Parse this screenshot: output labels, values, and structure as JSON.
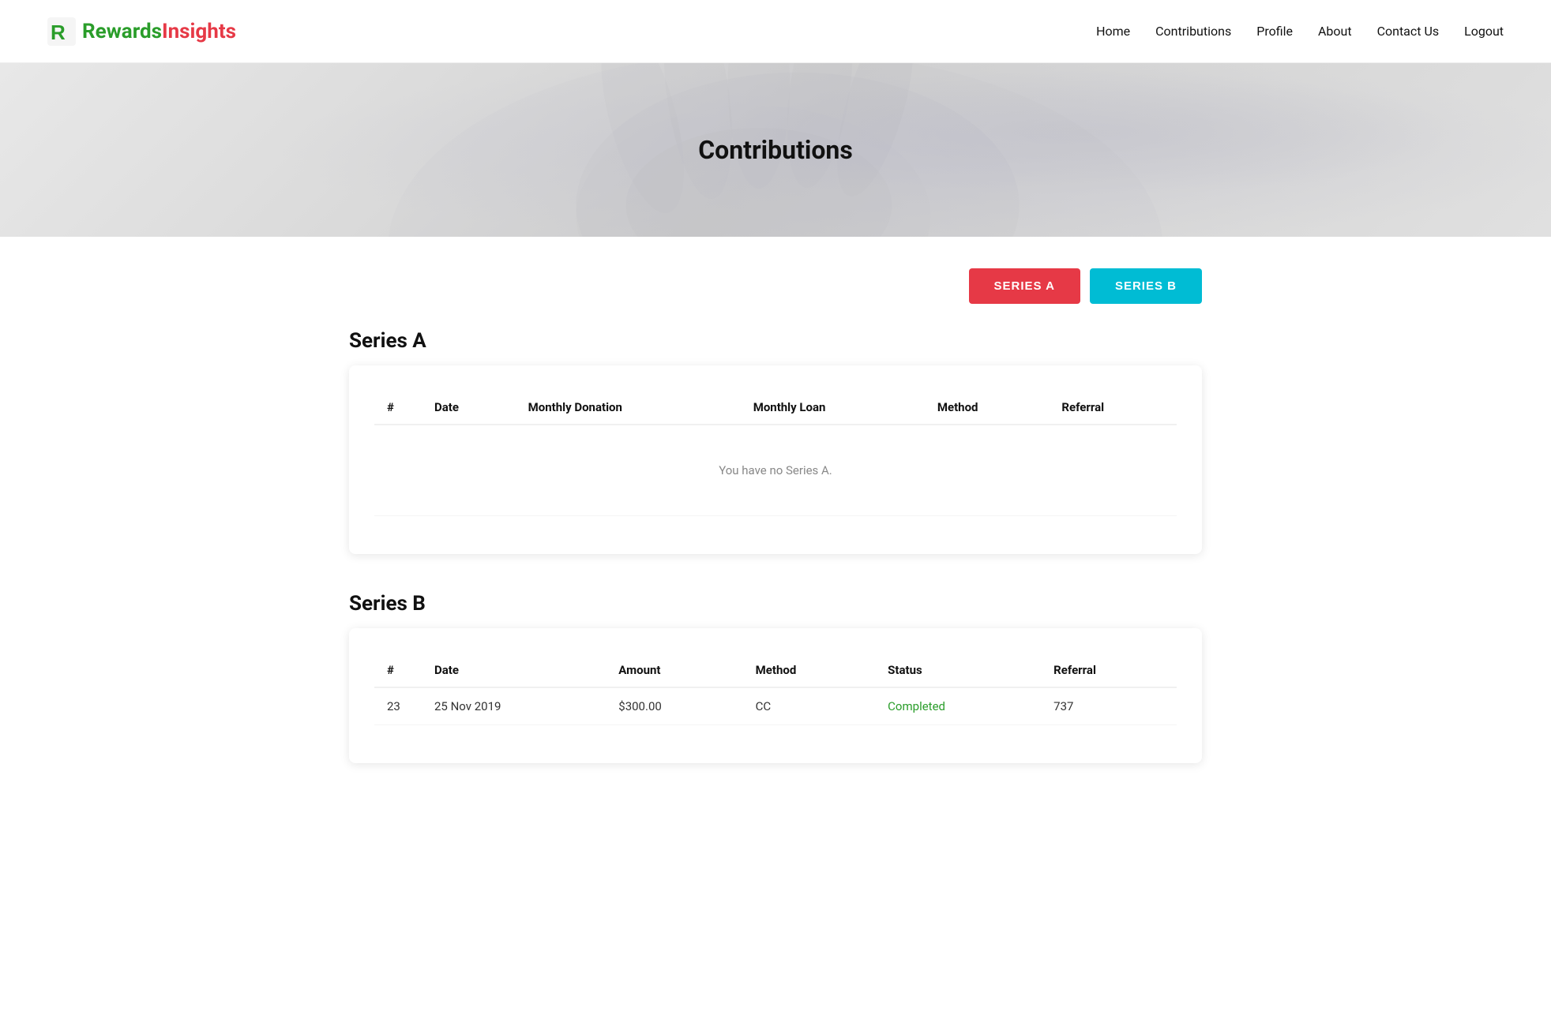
{
  "brand": {
    "logo_rewards": "Rewards",
    "logo_insights": "Insights",
    "logo_letter": "R"
  },
  "nav": {
    "links": [
      {
        "label": "Home",
        "id": "home"
      },
      {
        "label": "Contributions",
        "id": "contributions"
      },
      {
        "label": "Profile",
        "id": "profile"
      },
      {
        "label": "About",
        "id": "about"
      },
      {
        "label": "Contact Us",
        "id": "contact-us"
      },
      {
        "label": "Logout",
        "id": "logout"
      }
    ]
  },
  "hero": {
    "title": "Contributions"
  },
  "buttons": {
    "series_a": "SERIES A",
    "series_b": "SERIES B"
  },
  "series_a": {
    "heading": "Series A",
    "columns": [
      "#",
      "Date",
      "Monthly Donation",
      "Monthly Loan",
      "Method",
      "Referral"
    ],
    "empty_message": "You have no Series A."
  },
  "series_b": {
    "heading": "Series B",
    "columns": [
      "#",
      "Date",
      "Amount",
      "Method",
      "Status",
      "Referral"
    ],
    "rows": [
      {
        "number": "23",
        "date": "25 Nov 2019",
        "amount": "$300.00",
        "method": "CC",
        "status": "Completed",
        "referral": "737"
      }
    ]
  }
}
